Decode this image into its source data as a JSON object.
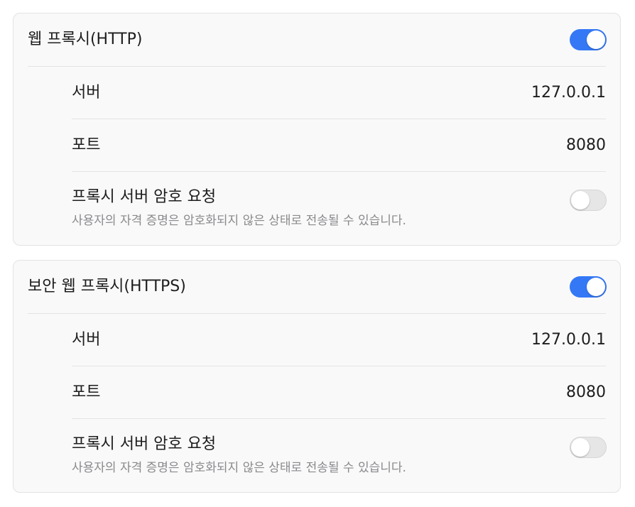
{
  "http_section": {
    "title": "웹 프록시(HTTP)",
    "enabled": true,
    "server_label": "서버",
    "server_value": "127.0.0.1",
    "port_label": "포트",
    "port_value": "8080",
    "auth_label": "프록시 서버 암호 요청",
    "auth_description": "사용자의 자격 증명은 암호화되지 않은 상태로 전송될 수 있습니다.",
    "auth_enabled": false
  },
  "https_section": {
    "title": "보안 웹 프록시(HTTPS)",
    "enabled": true,
    "server_label": "서버",
    "server_value": "127.0.0.1",
    "port_label": "포트",
    "port_value": "8080",
    "auth_label": "프록시 서버 암호 요청",
    "auth_description": "사용자의 자격 증명은 암호화되지 않은 상태로 전송될 수 있습니다.",
    "auth_enabled": false
  },
  "colors": {
    "accent": "#3478f6",
    "toggle_off": "#e6e6e6",
    "card_background": "#f9f9f9",
    "secondary_text": "#8a8a8e"
  }
}
